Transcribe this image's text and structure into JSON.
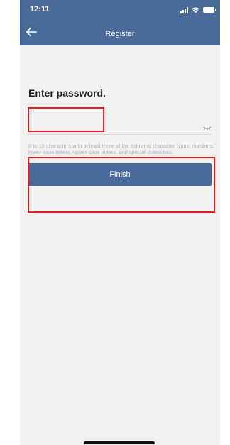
{
  "status_bar": {
    "time": "12:11",
    "icons": [
      "signal-icon",
      "wifi-icon",
      "battery-icon"
    ]
  },
  "nav": {
    "title": "Register",
    "back_icon": "arrow-left-icon"
  },
  "form": {
    "prompt": "Enter password.",
    "password_value": "",
    "password_placeholder": "",
    "toggle_icon": "eye-closed-icon",
    "hint": "8 to 16 characters with at least three of the following character types: numbers, lower-case letters, upper-case letters, and special characters.",
    "submit_label": "Finish"
  },
  "colors": {
    "header": "#4a6b9a",
    "button": "#4a6b9a",
    "background": "#f2f2f2",
    "annotation": "#e8191d",
    "hint_text": "#b3b3b3"
  }
}
